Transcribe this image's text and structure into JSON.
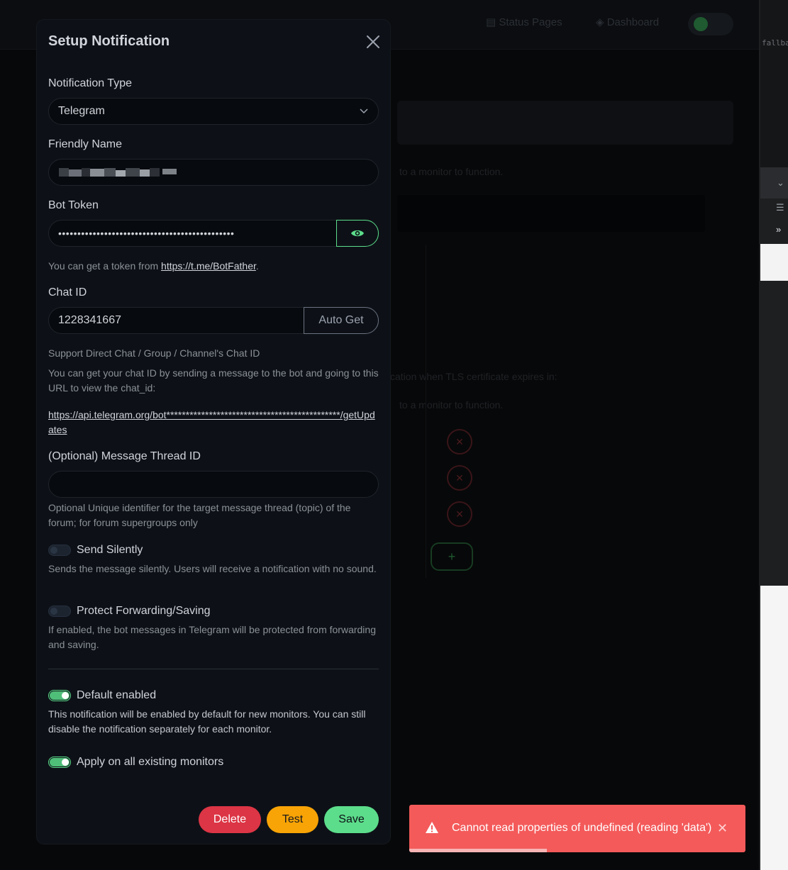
{
  "background": {
    "nav": [
      {
        "label": "Status Pages"
      },
      {
        "label": "Dashboard"
      }
    ],
    "help_text_1": "to a monitor to function.",
    "help_text_2": "cation when TLS certificate expires in:",
    "help_text_3": "to a monitor to function.",
    "editor_snippet": "fallbac"
  },
  "modal": {
    "title": "Setup Notification",
    "notification_type": {
      "label": "Notification Type",
      "value": "Telegram"
    },
    "friendly_name": {
      "label": "Friendly Name"
    },
    "bot_token": {
      "label": "Bot Token",
      "value": "••••••••••••••••••••••••••••••••••••••••••••••",
      "help_prefix": "You can get a token from ",
      "help_link": "https://t.me/BotFather",
      "help_suffix": "."
    },
    "chat_id": {
      "label": "Chat ID",
      "value": "1228341667",
      "auto_get_label": "Auto Get",
      "support_text": "Support Direct Chat / Group / Channel's Chat ID",
      "help_text": "You can get your chat ID by sending a message to the bot and going to this URL to view the chat_id:",
      "url": "https://api.telegram.org/bot*********************************************/getUpdates"
    },
    "thread_id": {
      "label": "(Optional) Message Thread ID",
      "value": "",
      "help_text": "Optional Unique identifier for the target message thread (topic) of the forum; for forum supergroups only"
    },
    "send_silently": {
      "label": "Send Silently",
      "enabled": false,
      "help_text": "Sends the message silently. Users will receive a notification with no sound."
    },
    "protect_forwarding": {
      "label": "Protect Forwarding/Saving",
      "enabled": false,
      "help_text": "If enabled, the bot messages in Telegram will be protected from forwarding and saving."
    },
    "default_enabled": {
      "label": "Default enabled",
      "enabled": true,
      "help_text": "This notification will be enabled by default for new monitors. You can still disable the notification separately for each monitor."
    },
    "apply_existing": {
      "label": "Apply on all existing monitors",
      "enabled": true
    },
    "buttons": {
      "delete": "Delete",
      "test": "Test",
      "save": "Save"
    }
  },
  "toast": {
    "message": "Cannot read properties of undefined (reading 'data')",
    "icon": "warning-icon",
    "progress": 0.41
  },
  "colors": {
    "accent": "#5cdd8b",
    "danger": "#dc3545",
    "warning": "#f8a306",
    "toast": "#f45a5a"
  }
}
